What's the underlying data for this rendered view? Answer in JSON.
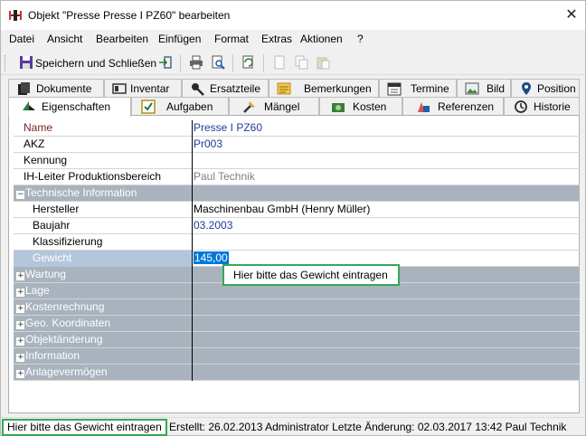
{
  "window": {
    "title": "Objekt \"Presse Presse I PZ60\" bearbeiten",
    "close_glyph": "✕"
  },
  "menu": [
    {
      "label": "Datei"
    },
    {
      "label": "Ansicht"
    },
    {
      "label": "Bearbeiten"
    },
    {
      "label": "Einfügen"
    },
    {
      "label": "Format"
    },
    {
      "label": "Extras"
    },
    {
      "label": "Aktionen"
    },
    {
      "label": "?"
    }
  ],
  "toolbar": {
    "save_close_label": "Speichern und Schließen"
  },
  "tabs_row1": [
    {
      "label": "Dokumente",
      "icon": "documents-icon"
    },
    {
      "label": "Inventar",
      "icon": "inventory-icon"
    },
    {
      "label": "Ersatzteile",
      "icon": "spare-parts-icon"
    },
    {
      "label": "Bemerkungen",
      "icon": "notes-icon"
    },
    {
      "label": "Termine",
      "icon": "calendar-icon"
    },
    {
      "label": "Bild",
      "icon": "image-icon"
    },
    {
      "label": "Position",
      "icon": "location-pin-icon"
    }
  ],
  "tabs_row2": [
    {
      "label": "Eigenschaften",
      "icon": "properties-icon",
      "active": true
    },
    {
      "label": "Aufgaben",
      "icon": "tasks-icon"
    },
    {
      "label": "Mängel",
      "icon": "defects-icon"
    },
    {
      "label": "Kosten",
      "icon": "costs-icon"
    },
    {
      "label": "Referenzen",
      "icon": "references-icon"
    },
    {
      "label": "Historie",
      "icon": "history-icon"
    }
  ],
  "properties": {
    "name": {
      "label": "Name",
      "value": "Presse I PZ60"
    },
    "akz": {
      "label": "AKZ",
      "value": "Pr003"
    },
    "kennung": {
      "label": "Kennung",
      "value": ""
    },
    "ih_leiter": {
      "label": "IH-Leiter Produktionsbereich",
      "value": "Paul Technik"
    },
    "tech_section": {
      "label": "Technische Information",
      "expander": "−"
    },
    "hersteller": {
      "label": "Hersteller",
      "value": "Maschinenbau GmbH  (Henry Müller)"
    },
    "baujahr": {
      "label": "Baujahr",
      "value": "03.2003"
    },
    "klassifizierung": {
      "label": "Klassifizierung",
      "value": ""
    },
    "gewicht": {
      "label": "Gewicht",
      "value": "145,00"
    },
    "sections": [
      {
        "label": "Wartung",
        "expander": "+"
      },
      {
        "label": "Lage",
        "expander": "+"
      },
      {
        "label": "Kostenrechnung",
        "expander": "+"
      },
      {
        "label": "Geo. Koordinaten",
        "expander": "+"
      },
      {
        "label": "Objektänderung",
        "expander": "+"
      },
      {
        "label": "Information",
        "expander": "+"
      },
      {
        "label": "Anlagevermögen",
        "expander": "+"
      }
    ]
  },
  "tooltip": "Hier bitte das Gewicht eintragen",
  "status": {
    "hint": "Hier bitte das Gewicht eintragen",
    "info": "Erstellt: 26.02.2013 Administrator  Letzte Änderung: 02.03.2017 13:42 Paul Technik"
  },
  "colors": {
    "section_bg": "#a8b3be",
    "value_blue": "#1f3b9b",
    "highlight_green": "#34a853",
    "selection_blue": "#0078d7"
  }
}
